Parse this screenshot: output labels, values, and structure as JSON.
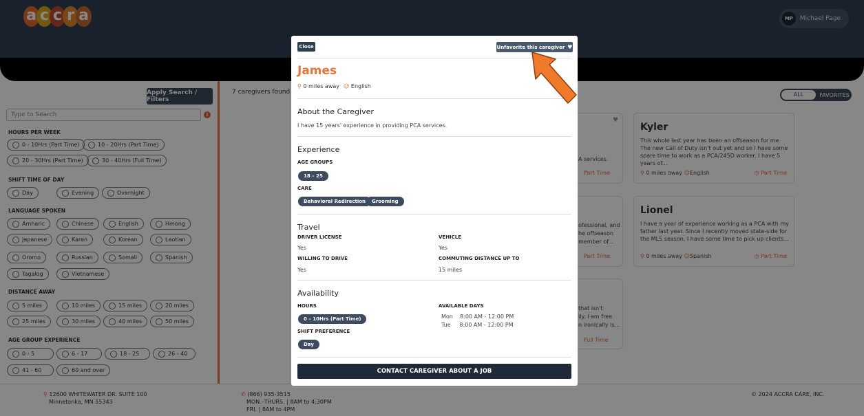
{
  "app": {
    "logo_letters": [
      "a",
      "c",
      "c",
      "r",
      "a"
    ],
    "user_initials": "MP",
    "user_name": "Michael Page"
  },
  "sidebar": {
    "apply_label": "Apply Search / Filters",
    "search_placeholder": "Type to Search",
    "hours_title": "HOURS PER WEEK",
    "hours": [
      "0 - 10Hrs (Part Time)",
      "10 - 20Hrs (Part Time)",
      "20 - 30Hrs (Part Time)",
      "30 - 40Hrs (Full Time)"
    ],
    "shift_title": "SHIFT TIME OF DAY",
    "shift": [
      "Day",
      "Evening",
      "Overnight"
    ],
    "lang_title": "LANGUAGE SPOKEN",
    "languages": [
      "Amharic",
      "Chinese",
      "English",
      "Hmong",
      "Japanese",
      "Karen",
      "Korean",
      "Laotian",
      "Oromo",
      "Russian",
      "Somali",
      "Spanish",
      "Tagalog",
      "Vietnamese"
    ],
    "distance_title": "DISTANCE AWAY",
    "distances": [
      "5 miles",
      "10 miles",
      "15 miles",
      "20 miles",
      "25 miles",
      "30 miles",
      "40 miles",
      "50 miles"
    ],
    "age_title": "AGE GROUP EXPERIENCE",
    "ages": [
      "0 - 5",
      "6 - 17",
      "18 - 25",
      "26 - 40",
      "41 - 60",
      "60 and over"
    ]
  },
  "results": {
    "found": "7 caregivers found",
    "toggle_all": "ALL",
    "toggle_fav": "FAVORITES",
    "kyler": {
      "name": "Kyler",
      "desc": "This whole last year has been an offseason for me. The new Call of Duty isn't out yet and so I have some spare time to work as a PCA/245D worker. I have 5 years of...",
      "meta": "0 miles away",
      "lang": "English",
      "time": "Part Time"
    },
    "lionel": {
      "name": "Lionel",
      "desc": "I have a year of experience working as a PCA with my father last year. Since I recently moved state-side for the MLS season, I have some time to pick up clients...",
      "meta": "0 miles away",
      "lang": "Spanish",
      "time": "Part Time"
    },
    "partial1": "A services.",
    "partial1_time": "Part Time",
    "partial2_a": "ofessional, and",
    "partial2_b": "he offseason",
    "partial2_c": "member of...",
    "partial2_time": "Part Time",
    "partial3_a": "that isn't",
    "partial3_b": "ily. I am free",
    "partial3_c": "n ironically is...",
    "partial3_time": "Full Time"
  },
  "footer": {
    "address1": "12600 WHITEWATER DR. SUITE 100",
    "address2": "Minnetonka, MN 55343",
    "phone": "(866) 935-3515",
    "hours1": "MON.–THURS. | 8AM to 4:30PM",
    "hours2": "FRI. | 8AM to 4PM",
    "copyright": "2024 ACCRA CARE, INC."
  },
  "modal": {
    "close_label": "Close",
    "unfavorite_label": "Unfavorite this caregiver",
    "name": "James",
    "distance": "0 miles away",
    "language": "English",
    "about_title": "About the Caregiver",
    "about_text": "I have 15 years' experience in providing PCA services.",
    "experience_title": "Experience",
    "age_groups_label": "AGE GROUPS",
    "age_groups": [
      "18 – 25"
    ],
    "care_label": "CARE",
    "care": [
      "Behavioral Redirection",
      "Grooming"
    ],
    "travel_title": "Travel",
    "driver_license_label": "DRIVER LICENSE",
    "driver_license": "Yes",
    "vehicle_label": "VEHICLE",
    "vehicle": "Yes",
    "willing_label": "WILLING TO DRIVE",
    "willing": "Yes",
    "commute_label": "COMMUTING DISTANCE UP TO",
    "commute": "15 miles",
    "availability_title": "Availability",
    "hours_label": "HOURS",
    "hours": "0 – 10Hrs (Part Time)",
    "days_label": "AVAILABLE DAYS",
    "days": [
      {
        "day": "Mon",
        "time": "8:00 AM - 12:00 PM"
      },
      {
        "day": "Tue",
        "time": "8:00 AM - 12:00 PM"
      }
    ],
    "shift_label": "SHIFT PREFERENCE",
    "shift": "Day",
    "contact_label": "CONTACT CAREGIVER ABOUT A JOB"
  },
  "colors": {
    "brand_orange": "#e8743a",
    "navy": "#2e3f53",
    "arrow": "#f07a2a"
  }
}
